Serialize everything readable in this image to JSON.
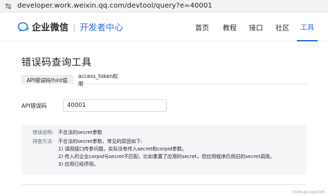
{
  "browser": {
    "url": "developer.work.weixin.qq.com/devtool/query?e=40001",
    "site_icon": "site-info-icon"
  },
  "header": {
    "brand": "企业微信",
    "separator": "|",
    "sub_brand": "开发者中心",
    "logo_icon": "wecom-logo-icon",
    "nav": [
      {
        "label": "首页",
        "active": false
      },
      {
        "label": "教程",
        "active": false
      },
      {
        "label": "接口",
        "active": false
      },
      {
        "label": "社区",
        "active": false
      },
      {
        "label": "工具",
        "active": true
      }
    ]
  },
  "page": {
    "title": "错误码查询工具",
    "tabs": [
      {
        "label": "API错误码/hint值",
        "active": true
      },
      {
        "label": "access_token权限",
        "active": false
      }
    ],
    "form": {
      "label": "API错误码",
      "value": "40001"
    },
    "result": {
      "desc_label": "错误说明:",
      "desc_value": "不合法的secret参数",
      "method_label": "排查方法:",
      "method_lines": [
        "不合法的secret参数，常见的原因如下:",
        "1) 调用接口传参问题，实际没有传入secret和corpid参数。",
        "2) 传入的企业corpid与secret不匹配，比如重置了应用的secret，但应用程序仍用旧的secret调用。",
        "3) 应用已经停用。"
      ]
    },
    "watermark": "CSDN @yuwg0204"
  },
  "colors": {
    "accent": "#2b6de5",
    "result_bg": "#f4f5f7"
  }
}
